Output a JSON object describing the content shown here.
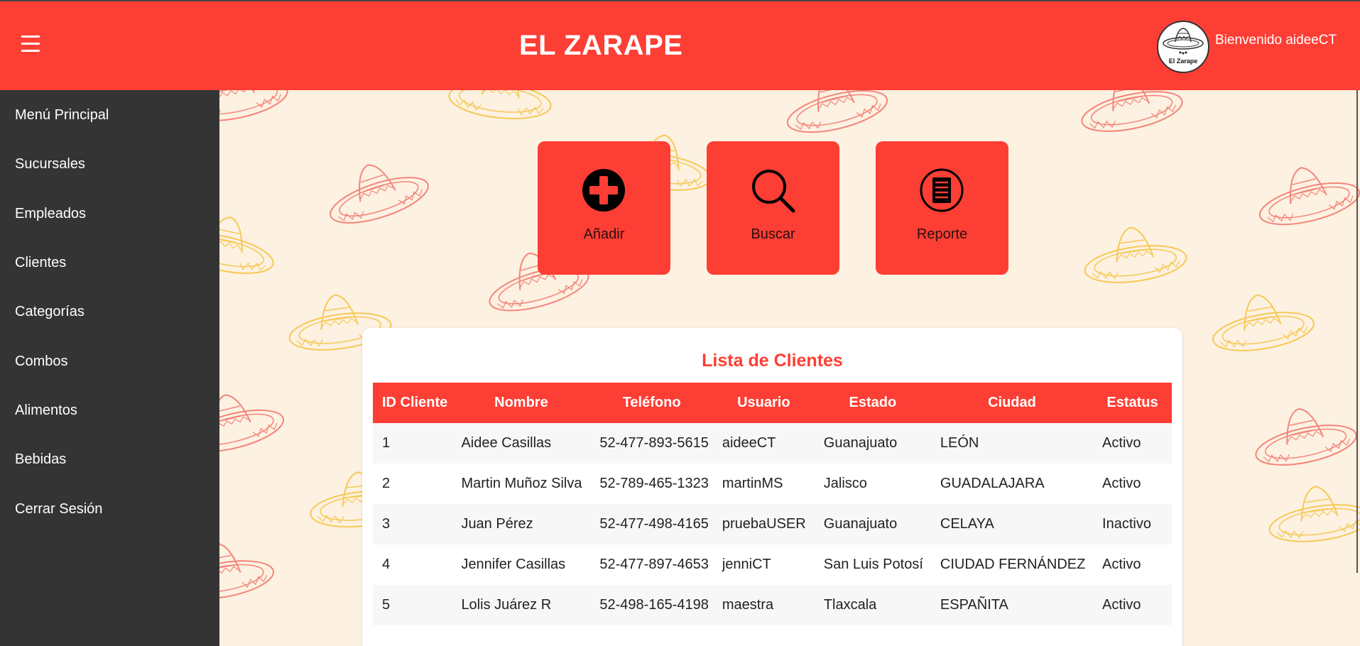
{
  "header": {
    "title": "EL ZARAPE",
    "welcome": "Bienvenido aideeCT",
    "logo_text": "El Zarape",
    "menu_icon": "hamburger-menu-icon"
  },
  "sidebar": {
    "items": [
      {
        "label": "Menú Principal"
      },
      {
        "label": "Sucursales"
      },
      {
        "label": "Empleados"
      },
      {
        "label": "Clientes"
      },
      {
        "label": "Categorías"
      },
      {
        "label": "Combos"
      },
      {
        "label": "Alimentos"
      },
      {
        "label": "Bebidas"
      },
      {
        "label": "Cerrar Sesión"
      }
    ]
  },
  "actions": [
    {
      "label": "Añadir",
      "icon": "add-circle-icon"
    },
    {
      "label": "Buscar",
      "icon": "search-icon"
    },
    {
      "label": "Reporte",
      "icon": "report-icon"
    }
  ],
  "table": {
    "title": "Lista de Clientes",
    "columns": [
      "ID Cliente",
      "Nombre",
      "Teléfono",
      "Usuario",
      "Estado",
      "Ciudad",
      "Estatus"
    ],
    "rows": [
      [
        "1",
        "Aidee Casillas",
        "52-477-893-5615",
        "aideeCT",
        "Guanajuato",
        "LEÓN",
        "Activo"
      ],
      [
        "2",
        "Martin Muñoz Silva",
        "52-789-465-1323",
        "martinMS",
        "Jalisco",
        "GUADALAJARA",
        "Activo"
      ],
      [
        "3",
        "Juan Pérez",
        "52-477-498-4165",
        "pruebaUSER",
        "Guanajuato",
        "CELAYA",
        "Inactivo"
      ],
      [
        "4",
        "Jennifer Casillas",
        "52-477-897-4653",
        "jenniCT",
        "San Luis Potosí",
        "CIUDAD FERNÁNDEZ",
        "Activo"
      ],
      [
        "5",
        "Lolis Juárez R",
        "52-498-165-4198",
        "maestra",
        "Tlaxcala",
        "ESPAÑITA",
        "Activo"
      ]
    ]
  },
  "colors": {
    "primary": "#fd3e34",
    "sidebar": "#343434",
    "background": "#fdf1e2",
    "sombrero_red": "#f07266",
    "sombrero_yellow": "#f5c444"
  }
}
